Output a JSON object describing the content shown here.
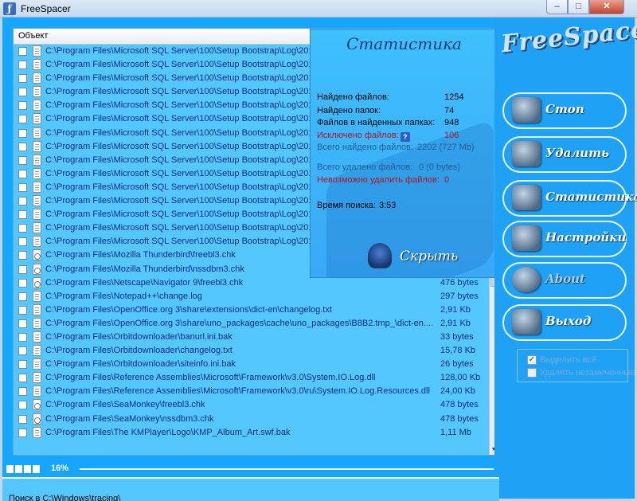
{
  "window": {
    "title": "FreeSpacer",
    "icon": "app-logo-icon"
  },
  "list": {
    "header": "Объект",
    "rows": [
      {
        "path": "C:\\Program Files\\Microsoft SQL Server\\100\\Setup Bootstrap\\Log\\201",
        "size": "",
        "icon": "doc-icon"
      },
      {
        "path": "C:\\Program Files\\Microsoft SQL Server\\100\\Setup Bootstrap\\Log\\201",
        "size": "",
        "icon": "doc-icon"
      },
      {
        "path": "C:\\Program Files\\Microsoft SQL Server\\100\\Setup Bootstrap\\Log\\201",
        "size": "",
        "icon": "doc-icon"
      },
      {
        "path": "C:\\Program Files\\Microsoft SQL Server\\100\\Setup Bootstrap\\Log\\201",
        "size": "",
        "icon": "doc-icon"
      },
      {
        "path": "C:\\Program Files\\Microsoft SQL Server\\100\\Setup Bootstrap\\Log\\201",
        "size": "",
        "icon": "doc-icon"
      },
      {
        "path": "C:\\Program Files\\Microsoft SQL Server\\100\\Setup Bootstrap\\Log\\201",
        "size": "",
        "icon": "doc-icon"
      },
      {
        "path": "C:\\Program Files\\Microsoft SQL Server\\100\\Setup Bootstrap\\Log\\201",
        "size": "",
        "icon": "doc-icon"
      },
      {
        "path": "C:\\Program Files\\Microsoft SQL Server\\100\\Setup Bootstrap\\Log\\201",
        "size": "",
        "icon": "doc-icon"
      },
      {
        "path": "C:\\Program Files\\Microsoft SQL Server\\100\\Setup Bootstrap\\Log\\201",
        "size": "",
        "icon": "doc-icon"
      },
      {
        "path": "C:\\Program Files\\Microsoft SQL Server\\100\\Setup Bootstrap\\Log\\201",
        "size": "",
        "icon": "doc-icon"
      },
      {
        "path": "C:\\Program Files\\Microsoft SQL Server\\100\\Setup Bootstrap\\Log\\201",
        "size": "",
        "icon": "doc-icon"
      },
      {
        "path": "C:\\Program Files\\Microsoft SQL Server\\100\\Setup Bootstrap\\Log\\201",
        "size": "",
        "icon": "doc-icon"
      },
      {
        "path": "C:\\Program Files\\Microsoft SQL Server\\100\\Setup Bootstrap\\Log\\201",
        "size": "",
        "icon": "doc-icon"
      },
      {
        "path": "C:\\Program Files\\Microsoft SQL Server\\100\\Setup Bootstrap\\Log\\201",
        "size": "",
        "icon": "doc-icon"
      },
      {
        "path": "C:\\Program Files\\Microsoft SQL Server\\100\\Setup Bootstrap\\Log\\201",
        "size": "",
        "icon": "doc-icon"
      },
      {
        "path": "C:\\Program Files\\Mozilla Thunderbird\\freebl3.chk",
        "size": "",
        "icon": "settings-file-icon"
      },
      {
        "path": "C:\\Program Files\\Mozilla Thunderbird\\nssdbm3.chk",
        "size": "",
        "icon": "settings-file-icon"
      },
      {
        "path": "C:\\Program Files\\Netscape\\Navigator 9\\freebl3.chk",
        "size": "476 bytes",
        "icon": "settings-file-icon"
      },
      {
        "path": "C:\\Program Files\\Notepad++\\change.log",
        "size": "297 bytes",
        "icon": "doc-icon"
      },
      {
        "path": "C:\\Program Files\\OpenOffice.org 3\\share\\extensions\\dict-en\\changelog.txt",
        "size": "2,91 Kb",
        "icon": "doc-icon"
      },
      {
        "path": "C:\\Program Files\\OpenOffice.org 3\\share\\uno_packages\\cache\\uno_packages\\B8B2.tmp_\\dict-en....",
        "size": "2,91 Kb",
        "icon": "doc-icon"
      },
      {
        "path": "C:\\Program Files\\Orbitdownloader\\banurl.ini.bak",
        "size": "33 bytes",
        "icon": "doc-icon"
      },
      {
        "path": "C:\\Program Files\\Orbitdownloader\\changelog.txt",
        "size": "15,78 Kb",
        "icon": "doc-icon"
      },
      {
        "path": "C:\\Program Files\\Orbitdownloader\\siteinfo.ini.bak",
        "size": "26 bytes",
        "icon": "doc-icon"
      },
      {
        "path": "C:\\Program Files\\Reference Assemblies\\Microsoft\\Framework\\v3.0\\System.IO.Log.dll",
        "size": "128,00 Kb",
        "icon": "doc-icon"
      },
      {
        "path": "C:\\Program Files\\Reference Assemblies\\Microsoft\\Framework\\v3.0\\ru\\System.IO.Log.Resources.dll",
        "size": "24,00 Kb",
        "icon": "doc-icon"
      },
      {
        "path": "C:\\Program Files\\SeaMonkey\\freebl3.chk",
        "size": "478 bytes",
        "icon": "settings-file-icon"
      },
      {
        "path": "C:\\Program Files\\SeaMonkey\\nssdbm3.chk",
        "size": "478 bytes",
        "icon": "settings-file-icon"
      },
      {
        "path": "C:\\Program Files\\The KMPlayer\\Logo\\KMP_Album_Art.swf.bak",
        "size": "1,11 Mb",
        "icon": "doc-icon"
      }
    ]
  },
  "stats": {
    "title": "Статистика",
    "found_files_label": "Найдено файлов:",
    "found_files_value": "1254",
    "found_folders_label": "Найдено папок:",
    "found_folders_value": "74",
    "files_in_folders_label": "Файлов в найденных папках:",
    "files_in_folders_value": "948",
    "excluded_label": "Исключено файлов:",
    "excluded_value": "106",
    "total_found_label": "Всего найдено файлов:",
    "total_found_value": "2202 (727 Mb)",
    "total_deleted_label": "Всего удалено файлов:",
    "total_deleted_value": "0 (0 bytes)",
    "cannot_delete_label": "Невозможно удалить файлов:",
    "cannot_delete_value": "0",
    "search_time_label": "Время поиска:",
    "search_time_value": "3:53",
    "hide_label": "Скрыть"
  },
  "sidebar": {
    "logo": "FreeSpacer",
    "buttons": [
      {
        "label": "Стоп",
        "icon": "stop-icon"
      },
      {
        "label": "Удалить",
        "icon": "delete-icon"
      },
      {
        "label": "Статистика",
        "icon": "statistics-icon"
      },
      {
        "label": "Настройки",
        "icon": "settings-icon"
      },
      {
        "label": "About",
        "icon": "about-icon"
      },
      {
        "label": "Выход",
        "icon": "exit-icon"
      }
    ],
    "options": [
      {
        "label": "Выделить всё",
        "checked": true
      },
      {
        "label": "Удалять незамеченные",
        "checked": false
      }
    ]
  },
  "progress": {
    "percent_label": "16%",
    "fraction": 0.16
  },
  "status": {
    "text": "Поиск в C:\\Windows\\tracing\\"
  },
  "colors": {
    "accent": "#16a6ff",
    "list_bg": "#54c7ff",
    "text_link": "#0b2a8a",
    "warning": "#b5121b"
  }
}
